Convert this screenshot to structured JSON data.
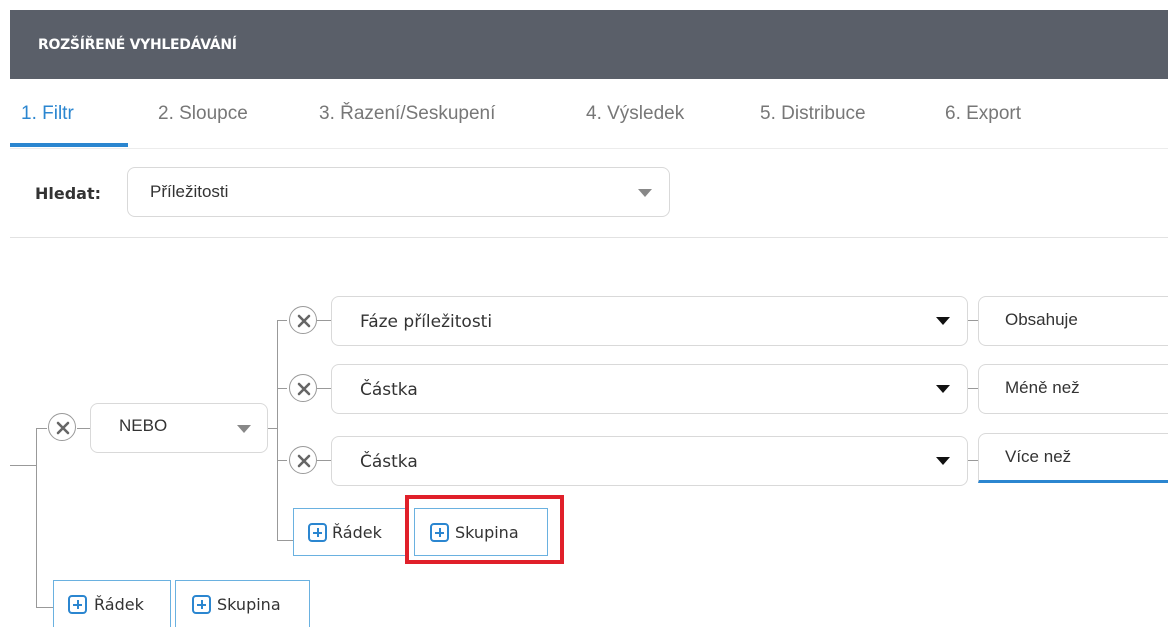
{
  "header": {
    "title": "ROZŠÍŘENÉ VYHLEDÁVÁNÍ"
  },
  "tabs": [
    {
      "label": "1. Filtr",
      "active": true
    },
    {
      "label": "2. Sloupce"
    },
    {
      "label": "3. Řazení/Seskupení"
    },
    {
      "label": "4. Výsledek"
    },
    {
      "label": "5. Distribuce"
    },
    {
      "label": "6. Export"
    }
  ],
  "search": {
    "label": "Hledat:",
    "value": "Příležitosti"
  },
  "group": {
    "operator": "NEBO"
  },
  "conditions": [
    {
      "field": "Fáze příležitosti",
      "operator": "Obsahuje"
    },
    {
      "field": "Částka",
      "operator": "Méně než"
    },
    {
      "field": "Částka",
      "operator": "Více než"
    }
  ],
  "inner_actions": {
    "add_row": "Řádek",
    "add_group": "Skupina"
  },
  "outer_actions": {
    "add_row": "Řádek",
    "add_group": "Skupina"
  },
  "colors": {
    "header_bg": "#5a5f69",
    "accent": "#2b86d0",
    "highlight": "#e0202a"
  }
}
